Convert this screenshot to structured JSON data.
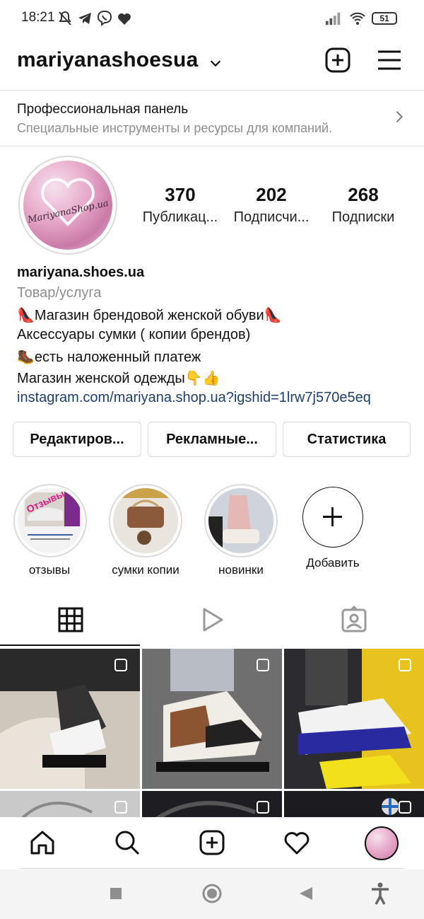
{
  "status_bar": {
    "time": "18:21",
    "battery": "51"
  },
  "header": {
    "username": "mariyanashoesua"
  },
  "pro_panel": {
    "title": "Профессиональная панель",
    "subtitle": "Специальные инструменты и ресурсы для компаний."
  },
  "avatar": {
    "logo_text": "MariyanaShop.ua"
  },
  "stats": [
    {
      "value": "370",
      "label": "Публикац..."
    },
    {
      "value": "202",
      "label": "Подписчи..."
    },
    {
      "value": "268",
      "label": "Подписки"
    }
  ],
  "bio": {
    "name": "mariyana.shoes.ua",
    "category": "Товар/услуга",
    "lines": [
      "👠Магазин брендовой женской обуви👠",
      "Аксессуары сумки ( копии брендов)",
      "🥾есть наложенный платеж",
      "Магазин женской одежды👇👍"
    ],
    "link": "instagram.com/mariyana.shop.ua?igshid=1lrw7j570e5eq"
  },
  "buttons": {
    "edit": "Редактиров...",
    "promotions": "Рекламные...",
    "insights": "Статистика"
  },
  "highlights": [
    {
      "label": "отзывы",
      "badge_text": "Отзывы"
    },
    {
      "label": "сумки копии"
    },
    {
      "label": "новинки"
    },
    {
      "label": "Добавить"
    }
  ],
  "colors": {
    "link": "#1e3f69",
    "secondary_text": "#8e8e8e",
    "divider": "#dbdbdb",
    "accent_pink": "#e7a9c9"
  },
  "icons": {
    "header": [
      "chevron-down-icon",
      "new-post-icon",
      "menu-icon"
    ],
    "tabs": [
      "grid-icon",
      "reels-icon",
      "tagged-icon"
    ],
    "bottom_nav": [
      "home-icon",
      "search-icon",
      "create-icon",
      "activity-icon",
      "profile-icon"
    ],
    "system_nav": [
      "recents-icon",
      "home-circle-icon",
      "back-icon",
      "accessibility-icon"
    ]
  }
}
